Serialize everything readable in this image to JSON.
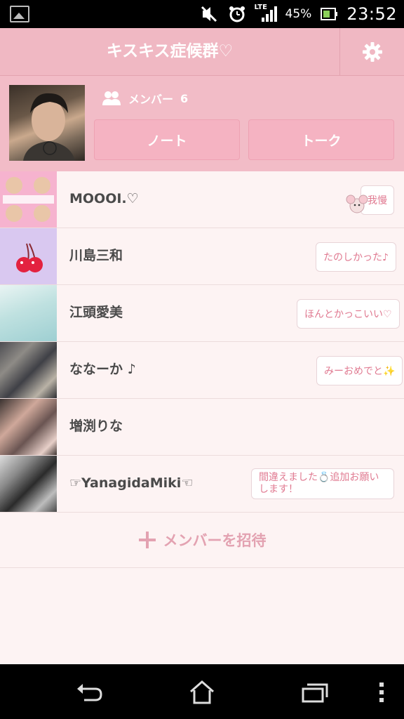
{
  "status_bar": {
    "network": "LTE",
    "battery_percent": "45%",
    "time": "23:52",
    "icons": [
      "image-notification-icon",
      "silent-mode-icon",
      "alarm-clock-icon",
      "signal-icon",
      "battery-icon"
    ]
  },
  "header": {
    "title": "キスキス症候群♡",
    "settings_icon": "gear-icon"
  },
  "group": {
    "members_label": "メンバー",
    "members_count": "6",
    "note_button": "ノート",
    "talk_button": "トーク"
  },
  "members": [
    {
      "name": "MOOOI.♡",
      "status": "我慢"
    },
    {
      "name": "川島三和",
      "status": "たのしかった♪"
    },
    {
      "name": "江頭愛美",
      "status": "ほんとかっこいい♡"
    },
    {
      "name": "ななーか ♪",
      "status": "みーおめでと✨"
    },
    {
      "name": "増渕りな",
      "status": ""
    },
    {
      "name": "☞YanagidaMiki☜",
      "status": "間違えました💍追加お願いします！"
    }
  ],
  "invite": {
    "label": "メンバーを招待",
    "icon": "plus-icon"
  },
  "nav": {
    "icons": [
      "back-icon",
      "home-icon",
      "recent-apps-icon",
      "menu-dots-icon"
    ]
  },
  "colors": {
    "header_bg": "#f0b8c3",
    "panel_bg": "#f2bcc7",
    "button_bg": "#f5b3c2",
    "list_bg": "#fdf3f3",
    "status_text": "#e07a91"
  }
}
